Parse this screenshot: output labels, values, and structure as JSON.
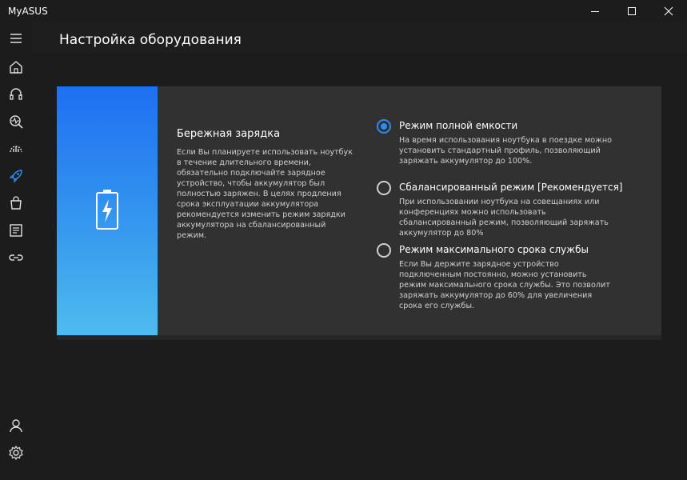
{
  "app": {
    "title": "MyASUS"
  },
  "window_controls": [
    "minimize",
    "maximize",
    "close"
  ],
  "sidebar": {
    "items": [
      {
        "name": "menu",
        "icon": "hamburger-icon"
      },
      {
        "name": "home",
        "icon": "home-icon"
      },
      {
        "name": "support",
        "icon": "headset-icon"
      },
      {
        "name": "diagnostics",
        "icon": "diagnostics-icon"
      },
      {
        "name": "system-info",
        "icon": "speedometer-icon"
      },
      {
        "name": "customization",
        "icon": "rocket-icon",
        "active": true
      },
      {
        "name": "store",
        "icon": "shopping-bag-icon"
      },
      {
        "name": "news",
        "icon": "document-icon"
      },
      {
        "name": "link",
        "icon": "link-icon"
      }
    ],
    "bottom_items": [
      {
        "name": "account",
        "icon": "user-icon"
      },
      {
        "name": "settings",
        "icon": "gear-icon"
      }
    ]
  },
  "header": {
    "title": "Настройка оборудования"
  },
  "card": {
    "icon": "battery-charging-icon",
    "title": "Бережная зарядка",
    "description": "Если Вы планируете использовать ноутбук в течение длительного времени, обязательно подключайте зарядное устройство, чтобы аккумулятор был полностью заряжен. В целях продления срока эксплуатации аккумулятора рекомендуется изменить режим зарядки аккумулятора на сбалансированный режим.",
    "options": [
      {
        "label": "Режим полной емкости",
        "description": "На время использования ноутбука в поездке можно установить стандартный профиль, позволяющий заряжать аккумулятор до 100%.",
        "selected": true
      },
      {
        "label": "Сбалансированный режим [Рекомендуется]",
        "description": "При использовании ноутбука на совещаниях или конференциях можно использовать сбалансированный режим, позволяющий заряжать аккумулятор до 80%",
        "selected": false
      },
      {
        "label": "Режим максимального срока службы",
        "description": "Если Вы держите зарядное устройство подключенным постоянно, можно установить режим максимального срока службы. Это позволит заряжать аккумулятор до 60% для увеличения срока его службы.",
        "selected": false
      }
    ]
  },
  "colors": {
    "accent": "#2b8cf2",
    "background": "#1c1c1c",
    "card": "#313131",
    "banner_top": "#1f6ff2",
    "banner_bottom": "#4fbbee"
  }
}
